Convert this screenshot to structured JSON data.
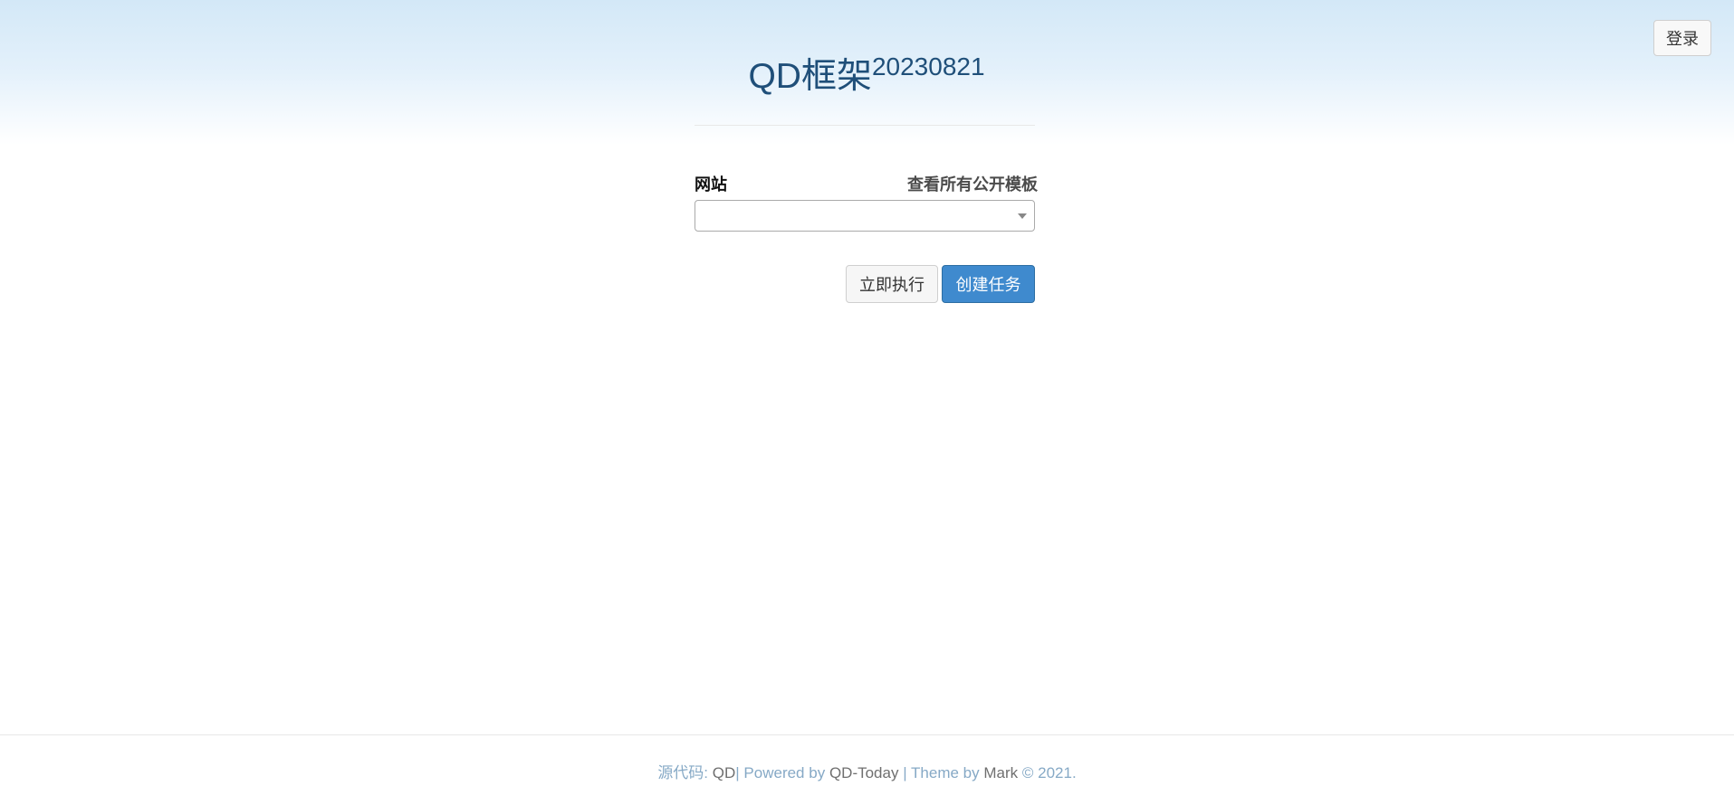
{
  "header": {
    "title_main": "QD框架",
    "title_version": "20230821",
    "login_label": "登录"
  },
  "form": {
    "site_label": "网站",
    "view_templates_label": "查看所有公开模板",
    "site_select": {
      "selected": ""
    },
    "run_now_label": "立即执行",
    "create_task_label": "创建任务"
  },
  "footer": {
    "source_label": "源代码:",
    "source_name": "QD",
    "powered_by_label": "| Powered by",
    "powered_by_name": "QD-Today",
    "theme_by_label": "| Theme by",
    "theme_author": "Mark",
    "copyright": "© 2021."
  },
  "colors": {
    "primary": "#3f8ace",
    "title": "#1f4f79",
    "footer_link": "#86a9c6",
    "footer_dark": "#6f6f6f",
    "gradient_top": "#d3e8f7"
  }
}
